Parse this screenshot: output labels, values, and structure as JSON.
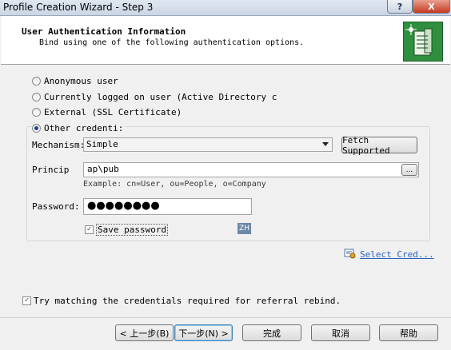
{
  "window": {
    "title": "Profile Creation Wizard - Step 3",
    "help_label": "?",
    "close_label": "X"
  },
  "header": {
    "title": "User Authentication Information",
    "subtitle": "Bind using one of the following authentication options."
  },
  "options": {
    "anonymous": "Anonymous user",
    "current": "Currently logged on user (Active Directory c",
    "external": "External (SSL Certificate)",
    "other": "Other credenti:",
    "selected": "other"
  },
  "mechanism": {
    "label": "Mechanism:",
    "value": "Simple",
    "fetch_label": "Fetch Supported"
  },
  "principal": {
    "label": "Princip",
    "value": "ap\\pub",
    "browse_label": "...",
    "example": "Example:  cn=User, ou=People, o=Company"
  },
  "password": {
    "label": "Password:",
    "masked": "●●●●●●●●"
  },
  "save_password": {
    "label": "Save password",
    "checked": true
  },
  "ime_badge": "ZH",
  "select_cred_label": "Select Cred...",
  "referral": {
    "label": "Try matching the credentials required for referral rebind.",
    "checked": true
  },
  "buttons": {
    "back": "< 上一步(B)",
    "next": "下一步(N) >",
    "finish": "完成",
    "cancel": "取消",
    "help": "帮助"
  },
  "colors": {
    "link": "#2a62c4",
    "icon": "#2f8f3f"
  }
}
